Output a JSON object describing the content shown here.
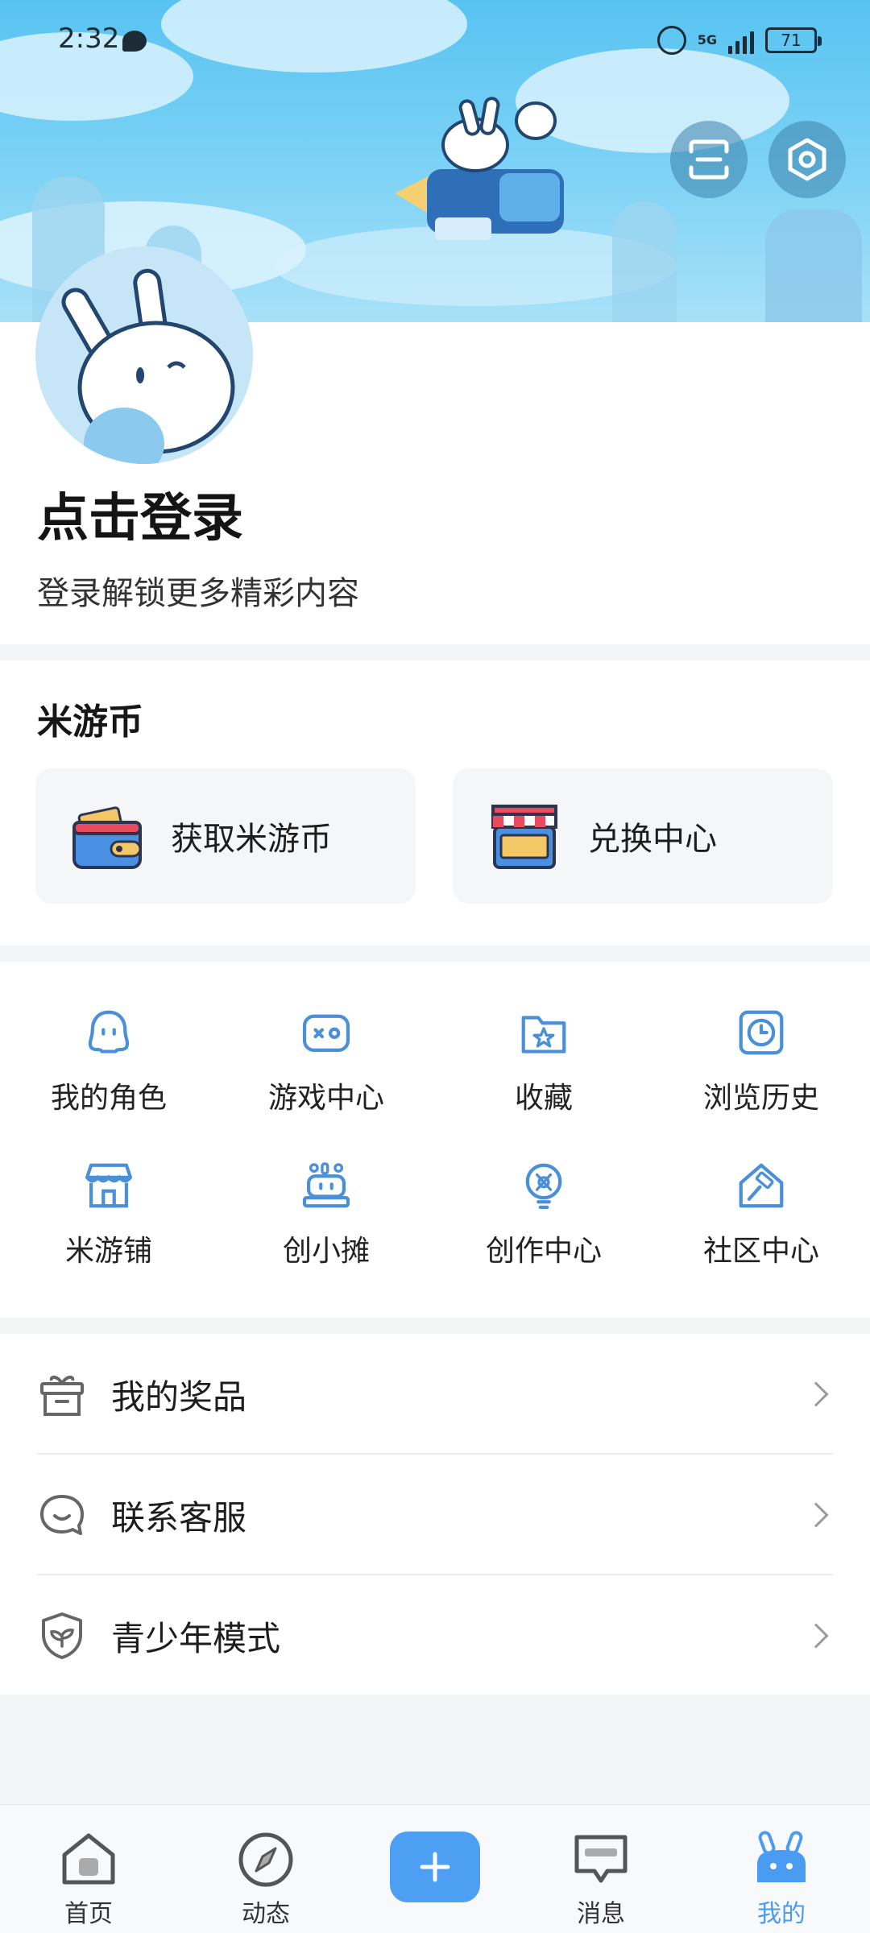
{
  "status_bar": {
    "time": "2:32",
    "network": "5G",
    "battery": "71"
  },
  "profile": {
    "title": "点击登录",
    "subtitle": "登录解锁更多精彩内容"
  },
  "coins": {
    "section_title": "米游币",
    "cards": [
      {
        "label": "获取米游币",
        "icon": "wallet-icon"
      },
      {
        "label": "兑换中心",
        "icon": "shop-awning-icon"
      }
    ]
  },
  "grid": [
    {
      "label": "我的角色",
      "icon": "character-icon"
    },
    {
      "label": "游戏中心",
      "icon": "gamepad-icon"
    },
    {
      "label": "收藏",
      "icon": "folder-star-icon"
    },
    {
      "label": "浏览历史",
      "icon": "clock-icon"
    },
    {
      "label": "米游铺",
      "icon": "store-icon"
    },
    {
      "label": "创小摊",
      "icon": "stall-icon"
    },
    {
      "label": "创作中心",
      "icon": "bulb-icon"
    },
    {
      "label": "社区中心",
      "icon": "gavel-house-icon"
    }
  ],
  "list": [
    {
      "label": "我的奖品",
      "icon": "gift-box-icon"
    },
    {
      "label": "联系客服",
      "icon": "chat-bubble-icon"
    },
    {
      "label": "青少年模式",
      "icon": "shield-leaf-icon"
    }
  ],
  "nav": [
    {
      "label": "首页",
      "icon": "home-icon"
    },
    {
      "label": "动态",
      "icon": "compass-icon"
    },
    {
      "label": "消息",
      "icon": "message-icon"
    },
    {
      "label": "我的",
      "icon": "bunny-icon"
    }
  ],
  "colors": {
    "accent": "#4c9ff3",
    "icon_blue": "#4a90d9",
    "banner_sky": "#57c3f1"
  }
}
